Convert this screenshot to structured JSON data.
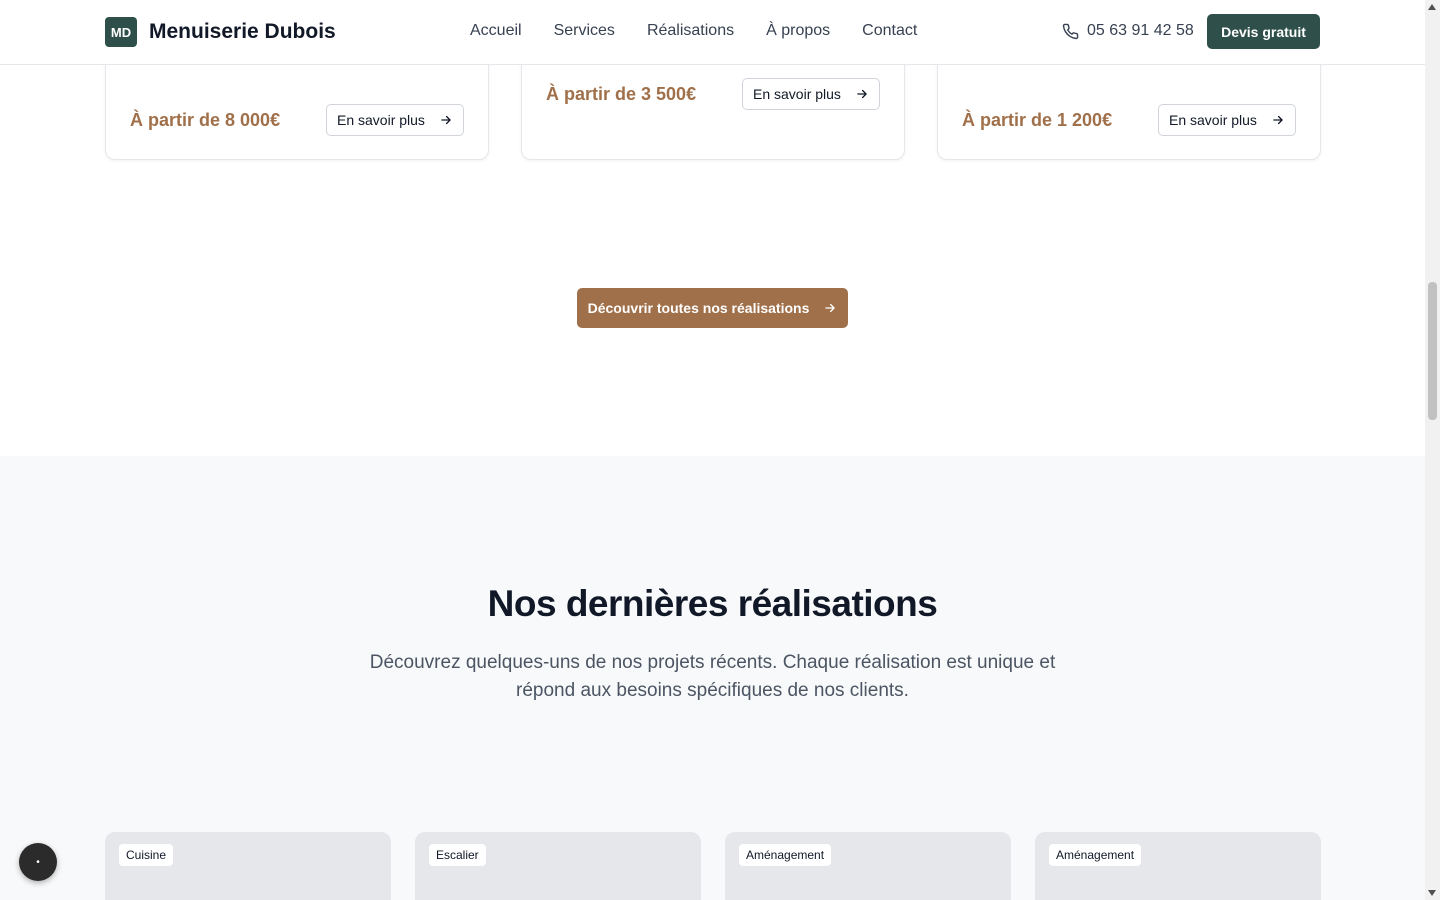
{
  "header": {
    "logo_initials": "MD",
    "brand": "Menuiserie Dubois",
    "nav": [
      "Accueil",
      "Services",
      "Réalisations",
      "À propos",
      "Contact"
    ],
    "phone": "05 63 91 42 58",
    "cta": "Devis gratuit"
  },
  "services": [
    {
      "price": "À partir de 8 000€",
      "more": "En savoir plus"
    },
    {
      "price": "À partir de 3 500€",
      "more": "En savoir plus"
    },
    {
      "price": "À partir de 1 200€",
      "more": "En savoir plus"
    }
  ],
  "discover_button": "Découvrir toutes nos réalisations",
  "realisations": {
    "title": "Nos dernières réalisations",
    "description": "Découvrez quelques-uns de nos projets récents. Chaque réalisation est unique et répond aux besoins spécifiques de nos clients.",
    "projects": [
      {
        "tag": "Cuisine"
      },
      {
        "tag": "Escalier"
      },
      {
        "tag": "Aménagement"
      },
      {
        "tag": "Aménagement"
      }
    ]
  },
  "colors": {
    "primary": "#2f4f4a",
    "accent": "#a0704a",
    "section_bg": "#f8f9fa"
  },
  "icons": {
    "phone": "phone-icon",
    "arrow": "arrow-right-icon"
  }
}
